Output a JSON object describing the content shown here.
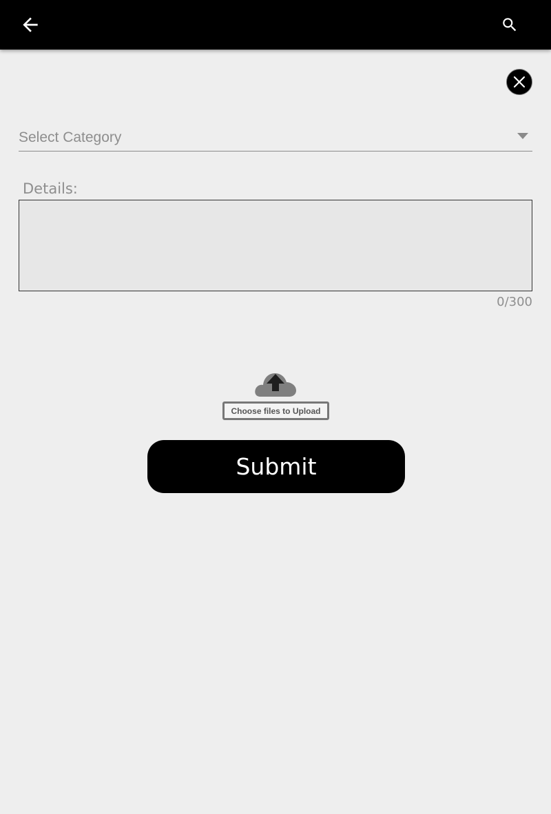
{
  "app_bar": {
    "back_icon": "arrow-left-icon",
    "search_icon": "search-icon",
    "background": "#000000"
  },
  "form": {
    "close_icon": "close-icon",
    "category": {
      "placeholder": "Select Category",
      "caret_icon": "caret-down-icon"
    },
    "details": {
      "label": "Details:",
      "value": "",
      "counter": "0/300"
    },
    "upload": {
      "icon": "cloud-upload-icon",
      "button_label": "Choose files to Upload"
    },
    "submit_label": "Submit"
  }
}
